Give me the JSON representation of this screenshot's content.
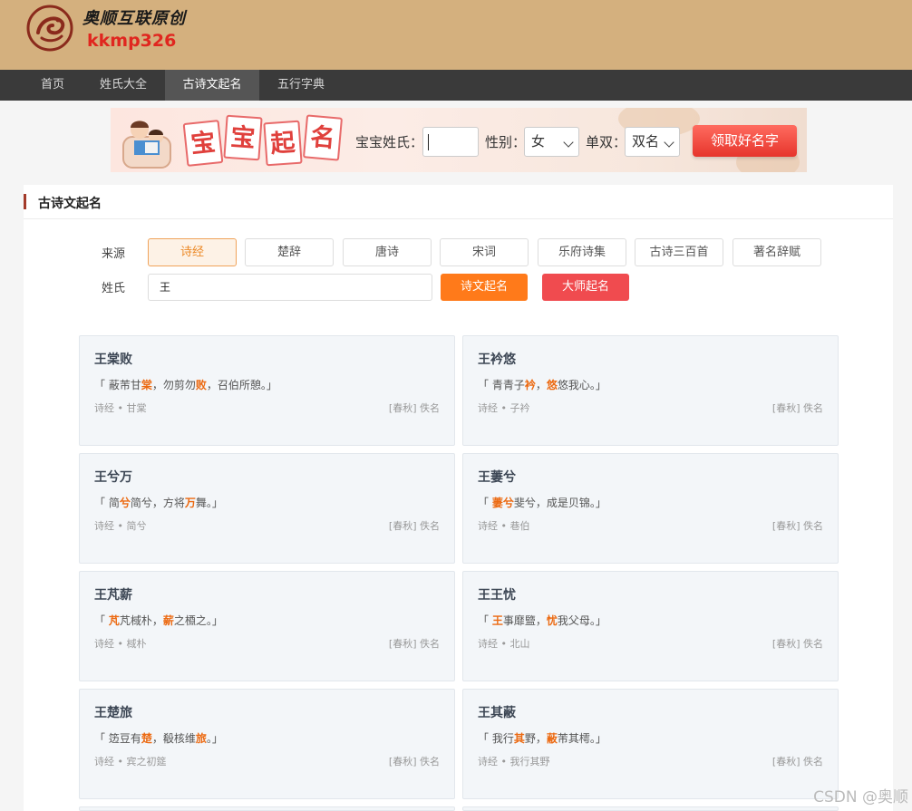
{
  "header": {
    "brand": "奥顺互联原创",
    "subbrand": "kkmp326"
  },
  "nav": {
    "items": [
      "首页",
      "姓氏大全",
      "古诗文起名",
      "五行字典"
    ],
    "active": "古诗文起名"
  },
  "banner": {
    "tiles": [
      "宝",
      "宝",
      "起",
      "名"
    ],
    "surname_label": "宝宝姓氏：",
    "surname_value": "",
    "gender_label": "性别：",
    "gender_value": "女",
    "count_label": "单双：",
    "count_value": "双名",
    "submit_label": "领取好名字"
  },
  "panel": {
    "title": "古诗文起名",
    "source_label": "来源",
    "sources": [
      "诗经",
      "楚辞",
      "唐诗",
      "宋词",
      "乐府诗集",
      "古诗三百首",
      "著名辞赋"
    ],
    "active_source": "诗经",
    "surname_label": "姓氏",
    "surname_value": "王",
    "poem_button": "诗文起名",
    "master_button": "大师起名"
  },
  "cards": [
    {
      "name": "王棠败",
      "verse": [
        [
          "「 蔽芾甘",
          false
        ],
        [
          "棠",
          true
        ],
        [
          "，勿剪勿",
          false
        ],
        [
          "败",
          true
        ],
        [
          "，召伯所憩。」",
          false
        ]
      ],
      "source": "诗经 • 甘棠",
      "author": "[春秋] 佚名"
    },
    {
      "name": "王衿悠",
      "verse": [
        [
          "「 青青子",
          false
        ],
        [
          "衿",
          true
        ],
        [
          "，",
          false
        ],
        [
          "悠",
          true
        ],
        [
          "悠我心。」",
          false
        ]
      ],
      "source": "诗经 • 子衿",
      "author": "[春秋] 佚名"
    },
    {
      "name": "王兮万",
      "verse": [
        [
          "「 简",
          false
        ],
        [
          "兮",
          true
        ],
        [
          "简兮，方将",
          false
        ],
        [
          "万",
          true
        ],
        [
          "舞。」",
          false
        ]
      ],
      "source": "诗经 • 简兮",
      "author": "[春秋] 佚名"
    },
    {
      "name": "王萋兮",
      "verse": [
        [
          "「 ",
          false
        ],
        [
          "萋兮",
          true
        ],
        [
          "斐兮，成是贝锦。」",
          false
        ]
      ],
      "source": "诗经 • 巷伯",
      "author": "[春秋] 佚名"
    },
    {
      "name": "王芃薪",
      "verse": [
        [
          "「 ",
          false
        ],
        [
          "芃",
          true
        ],
        [
          "芃棫朴，",
          false
        ],
        [
          "薪",
          true
        ],
        [
          "之槱之。」",
          false
        ]
      ],
      "source": "诗经 • 棫朴",
      "author": "[春秋] 佚名"
    },
    {
      "name": "王王忧",
      "verse": [
        [
          "「 ",
          false
        ],
        [
          "王",
          true
        ],
        [
          "事靡盬，",
          false
        ],
        [
          "忧",
          true
        ],
        [
          "我父母。」",
          false
        ]
      ],
      "source": "诗经 • 北山",
      "author": "[春秋] 佚名"
    },
    {
      "name": "王楚旅",
      "verse": [
        [
          "「 笾豆有",
          false
        ],
        [
          "楚",
          true
        ],
        [
          "，殽核维",
          false
        ],
        [
          "旅",
          true
        ],
        [
          "。」",
          false
        ]
      ],
      "source": "诗经 • 宾之初筵",
      "author": "[春秋] 佚名"
    },
    {
      "name": "王其蔽",
      "verse": [
        [
          "「 我行",
          false
        ],
        [
          "其",
          true
        ],
        [
          "野，",
          false
        ],
        [
          "蔽",
          true
        ],
        [
          "芾其樗。」",
          false
        ]
      ],
      "source": "诗经 • 我行其野",
      "author": "[春秋] 佚名"
    }
  ],
  "watermark": "CSDN @奥顺",
  "colors": {
    "header_bg": "#d4b07e",
    "nav_bg": "#3a3a3a",
    "accent_orange": "#ff7a1a",
    "accent_red": "#f04b4f",
    "highlight": "#ec6a12"
  }
}
